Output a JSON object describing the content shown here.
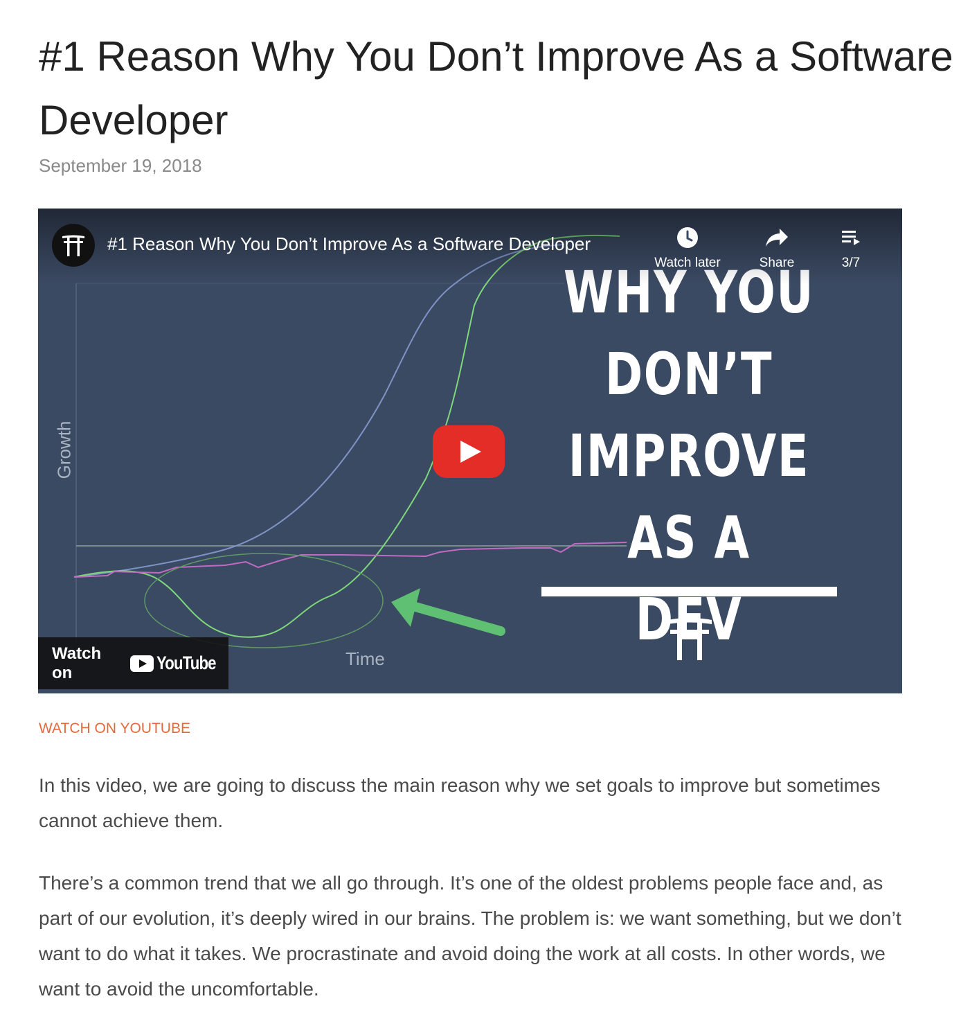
{
  "post": {
    "title": "#1 Reason Why You Don’t Improve As a Software Developer",
    "date": "September 19, 2018"
  },
  "video": {
    "title": "#1 Reason Why You Don’t Improve As a Software Developer",
    "watch_later": "Watch later",
    "share": "Share",
    "playlist_count": "3/7",
    "watch_on": "Watch on",
    "youtube_wordmark": "YouTube",
    "thumbnail": {
      "headline_lines": [
        "WHY YOU",
        "DON’T",
        "IMPROVE AS A",
        "DEV"
      ],
      "axis_y_label": "Growth",
      "axis_x_label": "Time",
      "background": "#3b4a63",
      "curve_colors": [
        "#7f93c6",
        "#7ed87a",
        "#c06bc2"
      ],
      "arrow_color": "#5fbf73"
    },
    "play_color": "#e52d27"
  },
  "links": {
    "watch_on_youtube": "WATCH ON YOUTUBE",
    "accent": "#e26a3e"
  },
  "paragraphs": [
    "In this video, we are going to discuss the main reason why we set goals to improve but sometimes cannot achieve them.",
    "There’s a common trend that we all go through. It’s one of the oldest problems people face and, as part of our evolution, it’s deeply wired in our brains. The problem is: we want something, but we don’t want to do what it takes. We procrastinate and avoid doing the work at all costs. In other words, we want to avoid the uncomfortable."
  ]
}
